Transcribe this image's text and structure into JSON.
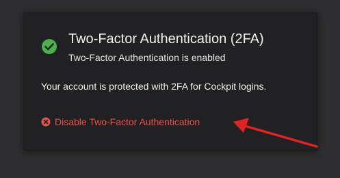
{
  "panel": {
    "title": "Two-Factor Authentication (2FA)",
    "subtitle": "Two-Factor Authentication is enabled",
    "description": "Your account is protected with 2FA for Cockpit logins.",
    "disable_label": "Disable Two-Factor Authentication",
    "status_icon": "check-circle-icon",
    "disable_icon": "x-circle-icon"
  },
  "colors": {
    "background": "#2e2e30",
    "card": "#212124",
    "success": "#4caf50",
    "danger": "#e5534b",
    "annotation_arrow": "#e02424"
  }
}
